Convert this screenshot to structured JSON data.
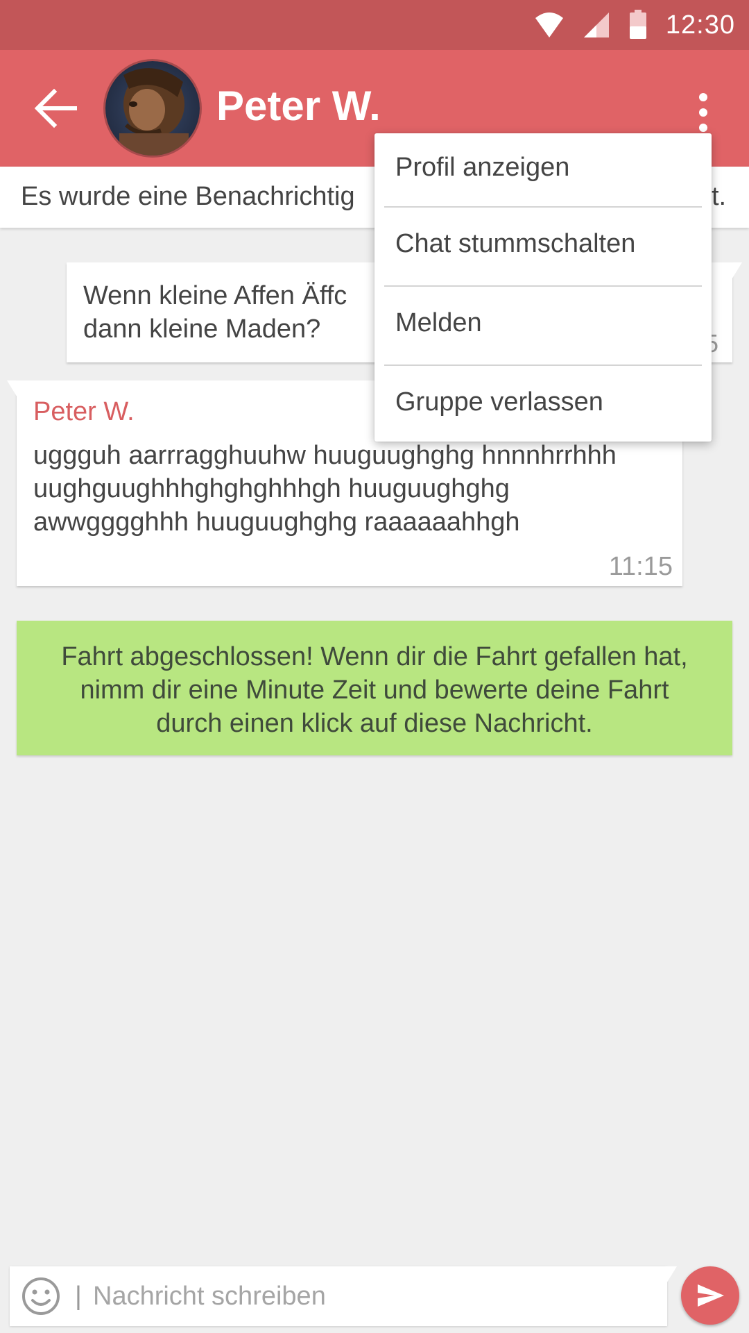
{
  "status_bar": {
    "time": "12:30",
    "icons": [
      "wifi-icon",
      "signal-icon",
      "battery-icon"
    ]
  },
  "app_bar": {
    "back_icon": "arrow-back-icon",
    "contact_name": "Peter W.",
    "more_icon": "more-vert-icon"
  },
  "notification_banner": {
    "text_start": "Es wurde eine Benachrichtig",
    "text_end": "t."
  },
  "messages": {
    "outgoing": {
      "text": "Wenn kleine Affen Äffc\ndann kleine Maden?",
      "time": "5"
    },
    "incoming": {
      "sender": "Peter W.",
      "text": "uggguh aarrragghuuhw huuguughghg hnnnhrrhhh uughguughhhghghghhhgh huuguughghg awwgggghhh huuguughghg raaaaaahhgh",
      "time": "11:15"
    }
  },
  "system_card": {
    "text": "Fahrt abgeschlossen! Wenn dir die Fahrt gefallen hat, nimm dir eine Minute Zeit und bewerte deine Fahrt durch einen klick auf diese Nachricht."
  },
  "menu": {
    "items": [
      {
        "label": "Profil anzeigen"
      },
      {
        "label": "Chat stummschalten"
      },
      {
        "label": "Melden"
      },
      {
        "label": "Gruppe verlassen"
      }
    ]
  },
  "compose": {
    "cursor": "|",
    "placeholder": "Nachricht schreiben",
    "emoji_icon": "emoji-icon",
    "send_icon": "send-icon"
  },
  "colors": {
    "primary": "#e06366",
    "status_bar": "#c25658",
    "accent_green": "#b8e681",
    "sender_name": "#d85e60"
  }
}
